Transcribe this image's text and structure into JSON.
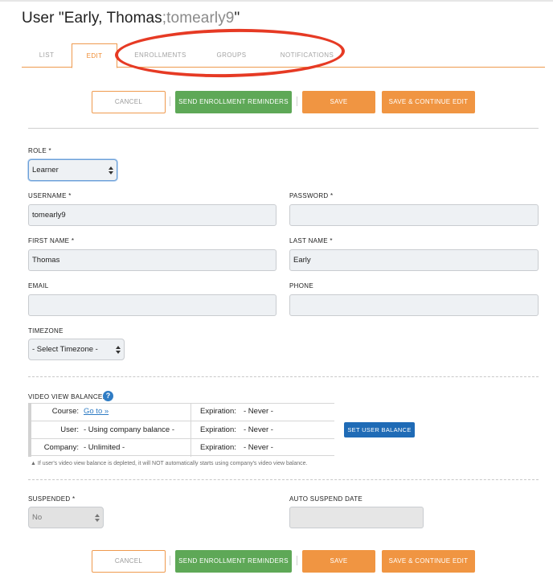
{
  "page": {
    "title_prefix": "User \"Early, Thomas",
    "title_handle": ";tomearly9",
    "title_suffix": "\""
  },
  "tabs": [
    {
      "label": "LIST",
      "active": false
    },
    {
      "label": "EDIT",
      "active": true
    },
    {
      "label": "ENROLLMENTS",
      "active": false
    },
    {
      "label": "GROUPS",
      "active": false
    },
    {
      "label": "NOTIFICATIONS",
      "active": false
    }
  ],
  "toolbar": {
    "cancel_label": "CANCEL",
    "send_reminders_label": "SEND ENROLLMENT REMINDERS",
    "save_label": "SAVE",
    "save_continue_label": "SAVE & CONTINUE EDIT"
  },
  "form": {
    "role": {
      "label": "ROLE *",
      "value": "Learner"
    },
    "username": {
      "label": "USERNAME *",
      "value": "tomearly9"
    },
    "password": {
      "label": "PASSWORD *",
      "value": ""
    },
    "first_name": {
      "label": "FIRST NAME *",
      "value": "Thomas"
    },
    "last_name": {
      "label": "LAST NAME *",
      "value": "Early"
    },
    "email": {
      "label": "EMAIL",
      "value": ""
    },
    "phone": {
      "label": "PHONE",
      "value": ""
    },
    "timezone": {
      "label": "TIMEZONE",
      "value": "- Select Timezone -"
    },
    "suspended": {
      "label": "SUSPENDED *",
      "value": "No"
    },
    "auto_suspend_date": {
      "label": "AUTO SUSPEND DATE",
      "value": ""
    }
  },
  "balance": {
    "label": "VIDEO VIEW BALANCE:",
    "help_glyph": "?",
    "rows": [
      {
        "key": "Course:",
        "value": "Go to »",
        "exp_key": "Expiration:",
        "exp_value": "- Never -"
      },
      {
        "key": "User:",
        "value": "- Using company balance -",
        "exp_key": "Expiration:",
        "exp_value": "- Never -"
      },
      {
        "key": "Company:",
        "value": "- Unlimited -",
        "exp_key": "Expiration:",
        "exp_value": "- Never -"
      }
    ],
    "set_button_label": "SET USER BALANCE",
    "note": "▲ If user's video view balance is depleted, it will NOT automatically starts using company's video view balance."
  },
  "colors": {
    "accent_orange": "#f09542",
    "green": "#5ea857",
    "blue": "#1f6bb6",
    "annotation_red": "#e63a24"
  }
}
